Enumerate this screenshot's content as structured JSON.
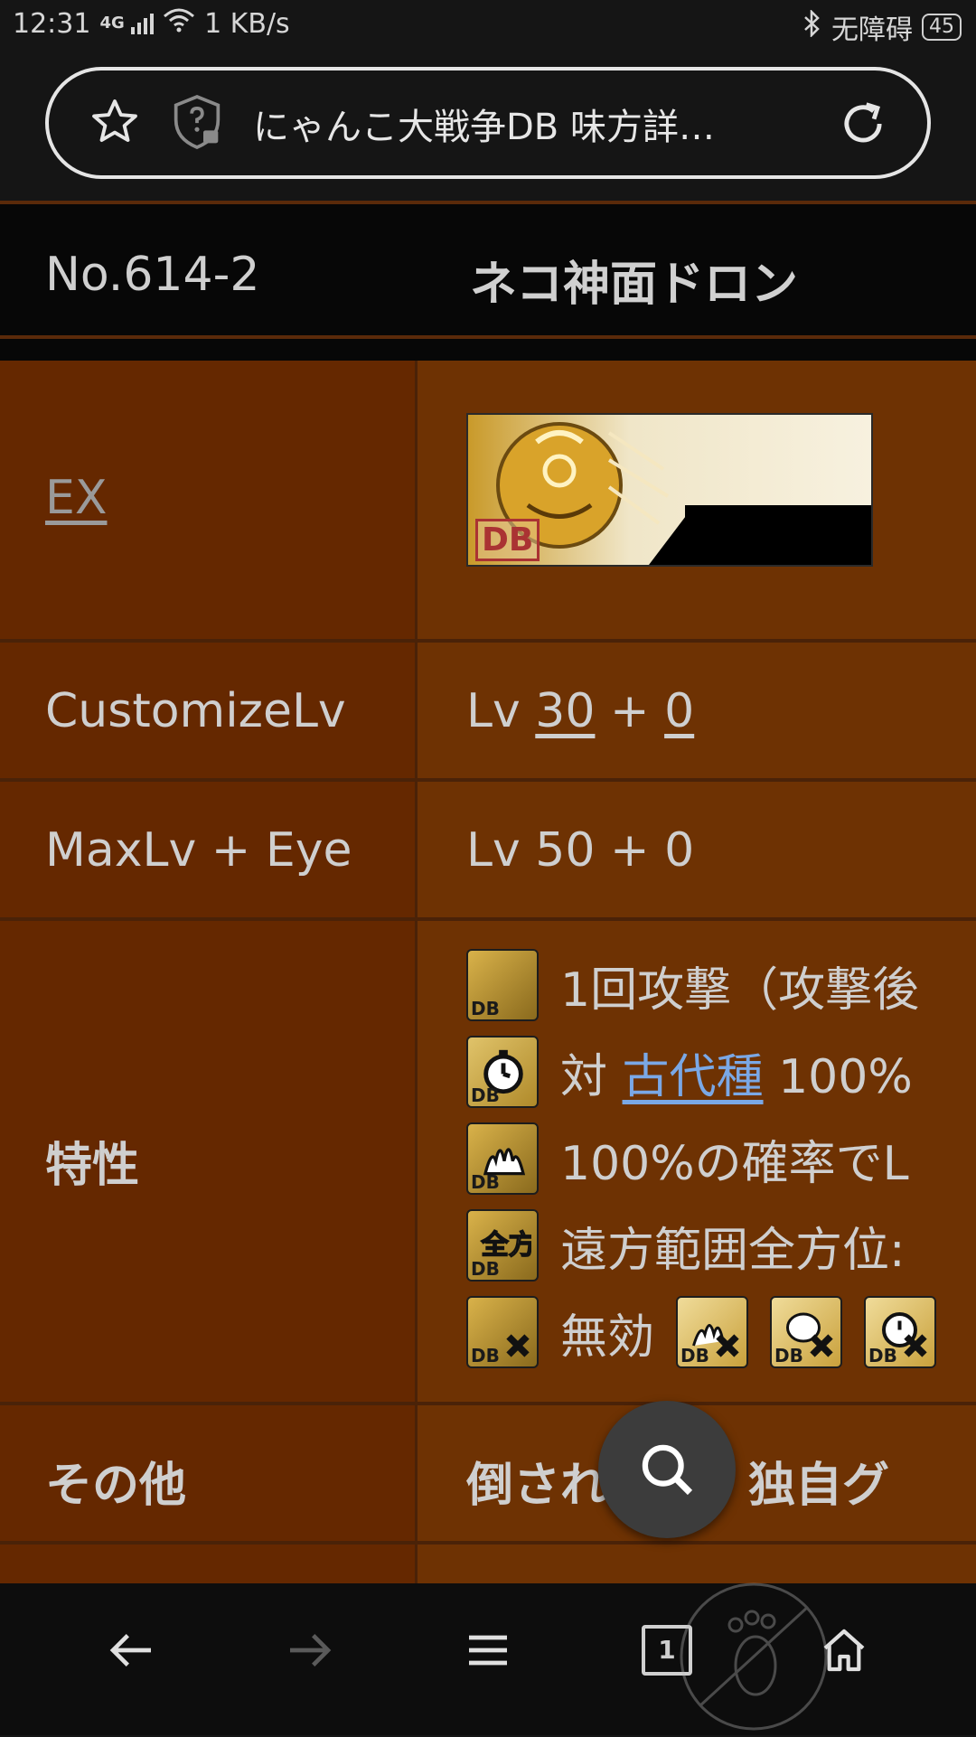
{
  "status": {
    "time": "12:31",
    "net": "4G",
    "speed": "1 KB/s",
    "accessibility": "无障碍",
    "battery": "45"
  },
  "browser": {
    "page_title": "にゃんこ大戦争DB 味方詳…",
    "icons": [
      "star-icon",
      "shield-question-icon",
      "reload-icon"
    ]
  },
  "unit": {
    "no": "No.614-2",
    "name": "ネコ神面ドロン"
  },
  "rows": {
    "ex_label": "EX",
    "ex_badge": "DB",
    "customize_label": "CustomizeLv",
    "customize_prefix": "Lv",
    "customize_level": "30",
    "customize_plus": "+",
    "customize_bonus": "0",
    "maxlv_label": "MaxLv + Eye",
    "maxlv_value": "Lv 50 + 0",
    "traits_label": "特性",
    "trait1": "1回攻撃（攻撃後",
    "trait2_pre": "対",
    "trait2_link": "古代種",
    "trait2_post": "100%",
    "trait3": "100%の確率でL",
    "trait4": "遠方範囲全方位:",
    "trait5": "無効",
    "other_label": "その他",
    "other_value": "倒され　時、独自グ"
  },
  "nav": {
    "tab_count": "1",
    "icons": [
      "back-arrow-icon",
      "forward-arrow-icon",
      "menu-icon",
      "tabs-icon",
      "home-icon"
    ]
  },
  "colors": {
    "page_bg": "#6b2d02",
    "header_bg": "#070707",
    "link": "#7aa8e6"
  }
}
